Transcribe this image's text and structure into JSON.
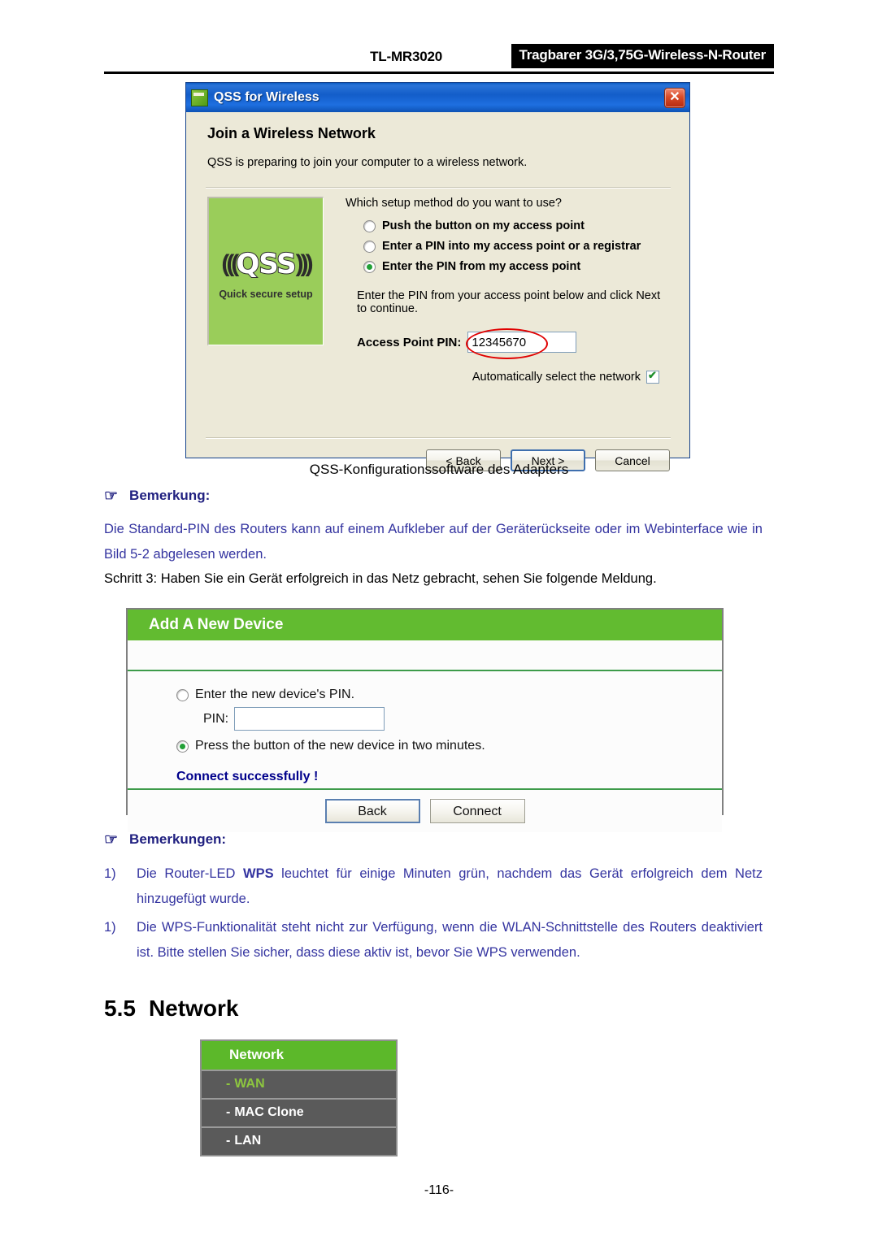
{
  "header": {
    "model": "TL-MR3020",
    "product": "Tragbarer 3G/3,75G-Wireless-N-Router"
  },
  "qss_dialog": {
    "title": "QSS for Wireless",
    "close_label": "✕",
    "heading": "Join a Wireless Network",
    "subheading": "QSS is preparing to join your computer to a wireless network.",
    "logo": {
      "arc_left": "(((",
      "text": "QSS",
      "arc_right": ")))",
      "caption": "Quick secure setup"
    },
    "question": "Which setup method do you want to use?",
    "options": [
      {
        "label": "Push the button on my access point",
        "selected": false
      },
      {
        "label": "Enter a PIN into my access point or a registrar",
        "selected": false
      },
      {
        "label": "Enter the PIN from my access point",
        "selected": true
      }
    ],
    "hint": "Enter the PIN from your access point below and click Next to continue.",
    "pin_label": "Access Point PIN:",
    "pin_value": "12345670",
    "auto_select_label": "Automatically select the network",
    "auto_select_checked": true,
    "buttons": {
      "back": "< Back",
      "next": "Next >",
      "cancel": "Cancel"
    },
    "annotation_color": "#e00000"
  },
  "figure_caption": "QSS-Konfigurationssoftware des Adapters",
  "note_1": {
    "hand_icon": "☞",
    "title": "Bemerkung:",
    "body": "Die Standard-PIN des Routers kann auf einem Aufkleber auf der Geräterückseite oder im Webinterface wie in Bild 5-2 abgelesen werden."
  },
  "step_3": "Schritt 3:  Haben Sie ein Gerät erfolgreich in das Netz gebracht, sehen Sie folgende Meldung.",
  "add_new_device": {
    "title": "Add A New Device",
    "options": [
      {
        "label": "Enter the new device's PIN.",
        "selected": false
      },
      {
        "label": "Press the button of the new device in two minutes.",
        "selected": true
      }
    ],
    "pin_label": "PIN:",
    "pin_value": "",
    "status": "Connect successfully !",
    "buttons": {
      "back": "Back",
      "connect": "Connect"
    }
  },
  "note_2": {
    "hand_icon": "☞",
    "title": "Bemerkungen:",
    "items": [
      {
        "marker": "1)",
        "text_before": "Die Router-LED ",
        "bold": "WPS",
        "text_after": " leuchtet für einige Minuten grün, nachdem das Gerät erfolgreich dem Netz hinzugefügt wurde."
      },
      {
        "marker": "1)",
        "text_before": "Die WPS-Funktionalität steht nicht zur Verfügung, wenn die WLAN-Schnittstelle des Routers deaktiviert ist. Bitte stellen Sie sicher, dass diese aktiv ist, bevor Sie WPS verwenden.",
        "bold": "",
        "text_after": ""
      }
    ]
  },
  "section": {
    "number": "5.5",
    "title": "Network"
  },
  "network_menu": {
    "header": "Network",
    "items": [
      {
        "dash": "-",
        "label": "WAN",
        "active": true
      },
      {
        "dash": "-",
        "label": "MAC Clone",
        "active": false
      },
      {
        "dash": "-",
        "label": "LAN",
        "active": false
      }
    ]
  },
  "page_number": "-116-",
  "colors": {
    "brand_green": "#62bb30",
    "menu_green": "#5cb82a",
    "menu_gray": "#5a5a5a",
    "active_green": "#8dc63f",
    "note_blue": "#3434a0",
    "title_blue": "#202080",
    "annotation_red": "#e00000"
  }
}
